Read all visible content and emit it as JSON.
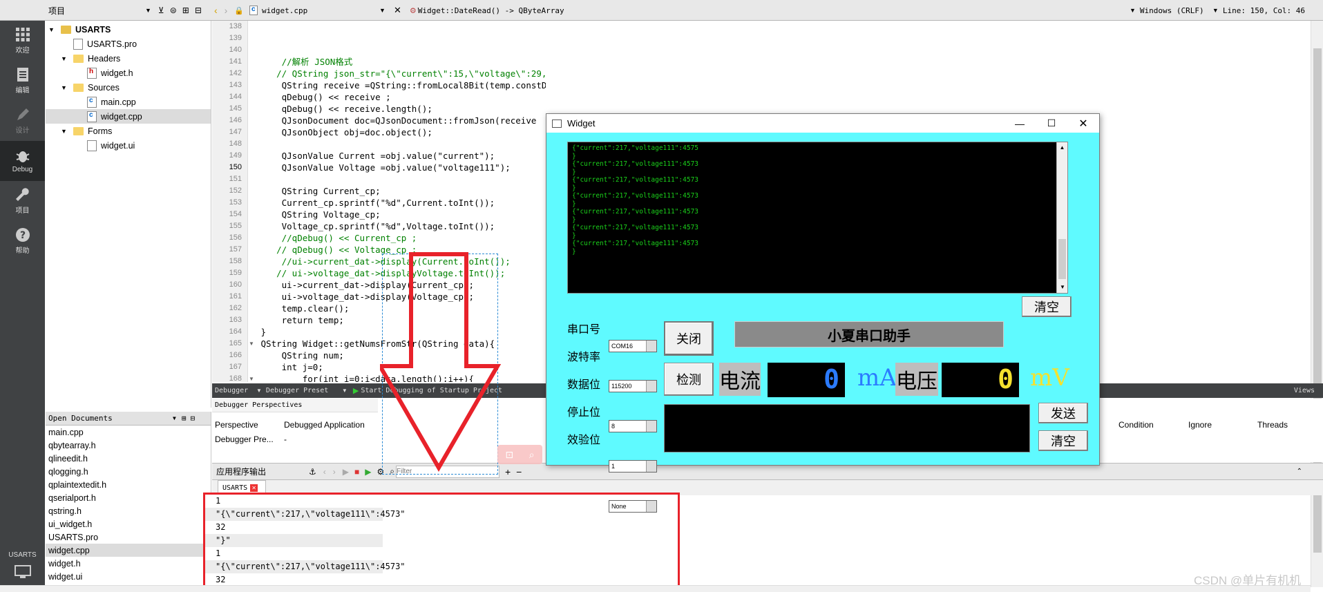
{
  "topbar": {
    "project_dropdown": "项目",
    "file_tab": "widget.cpp",
    "function_crumb": "Widget::DateRead() -> QByteArray",
    "line_ending": "Windows (CRLF)",
    "cursor_pos": "Line: 150, Col: 46"
  },
  "modes": [
    {
      "label": "欢迎",
      "icon": "grid-icon"
    },
    {
      "label": "编辑",
      "icon": "document-icon"
    },
    {
      "label": "设计",
      "icon": "pen-icon"
    },
    {
      "label": "Debug",
      "icon": "bug-icon"
    },
    {
      "label": "项目",
      "icon": "wrench-icon"
    },
    {
      "label": "帮助",
      "icon": "help-icon"
    }
  ],
  "kit": {
    "label": "USARTS"
  },
  "tree": {
    "root": "USARTS",
    "pro": "USARTS.pro",
    "headers": "Headers",
    "widget_h": "widget.h",
    "sources": "Sources",
    "main_cpp": "main.cpp",
    "widget_cpp": "widget.cpp",
    "forms": "Forms",
    "widget_ui": "widget.ui"
  },
  "open_documents": {
    "title": "Open Documents",
    "items": [
      "main.cpp",
      "qbytearray.h",
      "qlineedit.h",
      "qlogging.h",
      "qplaintextedit.h",
      "qserialport.h",
      "qstring.h",
      "ui_widget.h",
      "USARTS.pro",
      "widget.cpp",
      "widget.h",
      "widget.ui"
    ]
  },
  "code": {
    "line_numbers": [
      "138",
      "139",
      "140",
      "141",
      "142",
      "143",
      "144",
      "145",
      "146",
      "147",
      "148",
      "149",
      "150",
      "151",
      "152",
      "153",
      "154",
      "155",
      "156",
      "157",
      "158",
      "159",
      "160",
      "161",
      "162",
      "163",
      "164",
      "165",
      "166",
      "167",
      "168"
    ],
    "lines": [
      "",
      "",
      "",
      "     //解析 JSON格式",
      "    // QString json_str=\"{\\\"current\\\":15,\\\"voltage\\\":29,\\\"yan\\\":29}\";",
      "     QString receive =QString::fromLocal8Bit(temp.constData());",
      "     qDebug() << receive ;",
      "     qDebug() << receive.length();",
      "     QJsonDocument doc=QJsonDocument::fromJson(receive",
      "     QJsonObject obj=doc.object();",
      "",
      "     QJsonValue Current =obj.value(\"current\");",
      "     QJsonValue Voltage =obj.value(\"voltage111\");",
      "",
      "     QString Current_cp;",
      "     Current_cp.sprintf(\"%d\",Current.toInt());",
      "     QString Voltage_cp;",
      "     Voltage_cp.sprintf(\"%d\",Voltage.toInt());",
      "     //qDebug() << Current_cp ;",
      "    // qDebug() << Voltage_cp ;",
      "     //ui->current_dat->display(Current.toInt());",
      "    // ui->voltage_dat->displayVoltage.toInt());",
      "     ui->current_dat->display(Current_cp);",
      "     ui->voltage_dat->display(Voltage_cp);",
      "     temp.clear();",
      "     return temp;",
      " }",
      " QString Widget::getNumsFromStr(QString data){",
      "     QString num;",
      "     int j=0;",
      "         for(int i=0;i<data.length();i++){"
    ]
  },
  "debugger": {
    "bar_debugger": "Debugger",
    "bar_preset": "Debugger Preset",
    "bar_start": "Start Debugging of Startup Project",
    "views": "Views",
    "perspectives_title": "Debugger Perspectives",
    "col_perspective": "Perspective",
    "col_app": "Debugged Application",
    "row_perspective": "Debugger Pre...",
    "row_app": "-",
    "col_condition": "Condition",
    "col_ignore": "Ignore",
    "col_threads": "Threads"
  },
  "app_output": {
    "title": "应用程序输出",
    "filter_placeholder": "Filter",
    "tab": "USARTS",
    "lines": [
      "1",
      "\"{\\\"current\\\":217,\\\"voltage111\\\":4573\"",
      "32",
      "\"}\"",
      "1",
      "\"{\\\"current\\\":217,\\\"voltage111\\\":4573\"",
      "32"
    ]
  },
  "widget_window": {
    "title": "Widget",
    "terminal_lines": [
      "{\"current\":217,\"voltage111\":4575",
      "}",
      "{\"current\":217,\"voltage111\":4573",
      "}",
      "{\"current\":217,\"voltage111\":4573",
      "}",
      "{\"current\":217,\"voltage111\":4573",
      "}",
      "{\"current\":217,\"voltage111\":4573",
      "}",
      "{\"current\":217,\"voltage111\":4573",
      "}",
      "{\"current\":217,\"voltage111\":4573",
      "}"
    ],
    "clear_top": "清空",
    "port_label": "串口号",
    "port_value": "COM16",
    "baud_label": "波特率",
    "baud_value": "115200",
    "databits_label": "数据位",
    "databits_value": "8",
    "stopbits_label": "停止位",
    "stopbits_value": "1",
    "parity_label": "效验位",
    "parity_value": "None",
    "close_button": "关闭",
    "banner": "小夏串口助手",
    "detect_button": "检测",
    "current_label": "电流",
    "current_value": "0",
    "current_unit": "mA",
    "voltage_label": "电压",
    "voltage_value": "0",
    "voltage_unit": "mV",
    "send_button": "发送",
    "clear_bottom": "清空"
  },
  "watermark": "CSDN @单片有机机",
  "colors": {
    "accent_red": "#e8222a",
    "widget_bg": "#5ffaff",
    "lcd_blue": "#2b7bff",
    "lcd_yellow": "#f4e12e"
  }
}
